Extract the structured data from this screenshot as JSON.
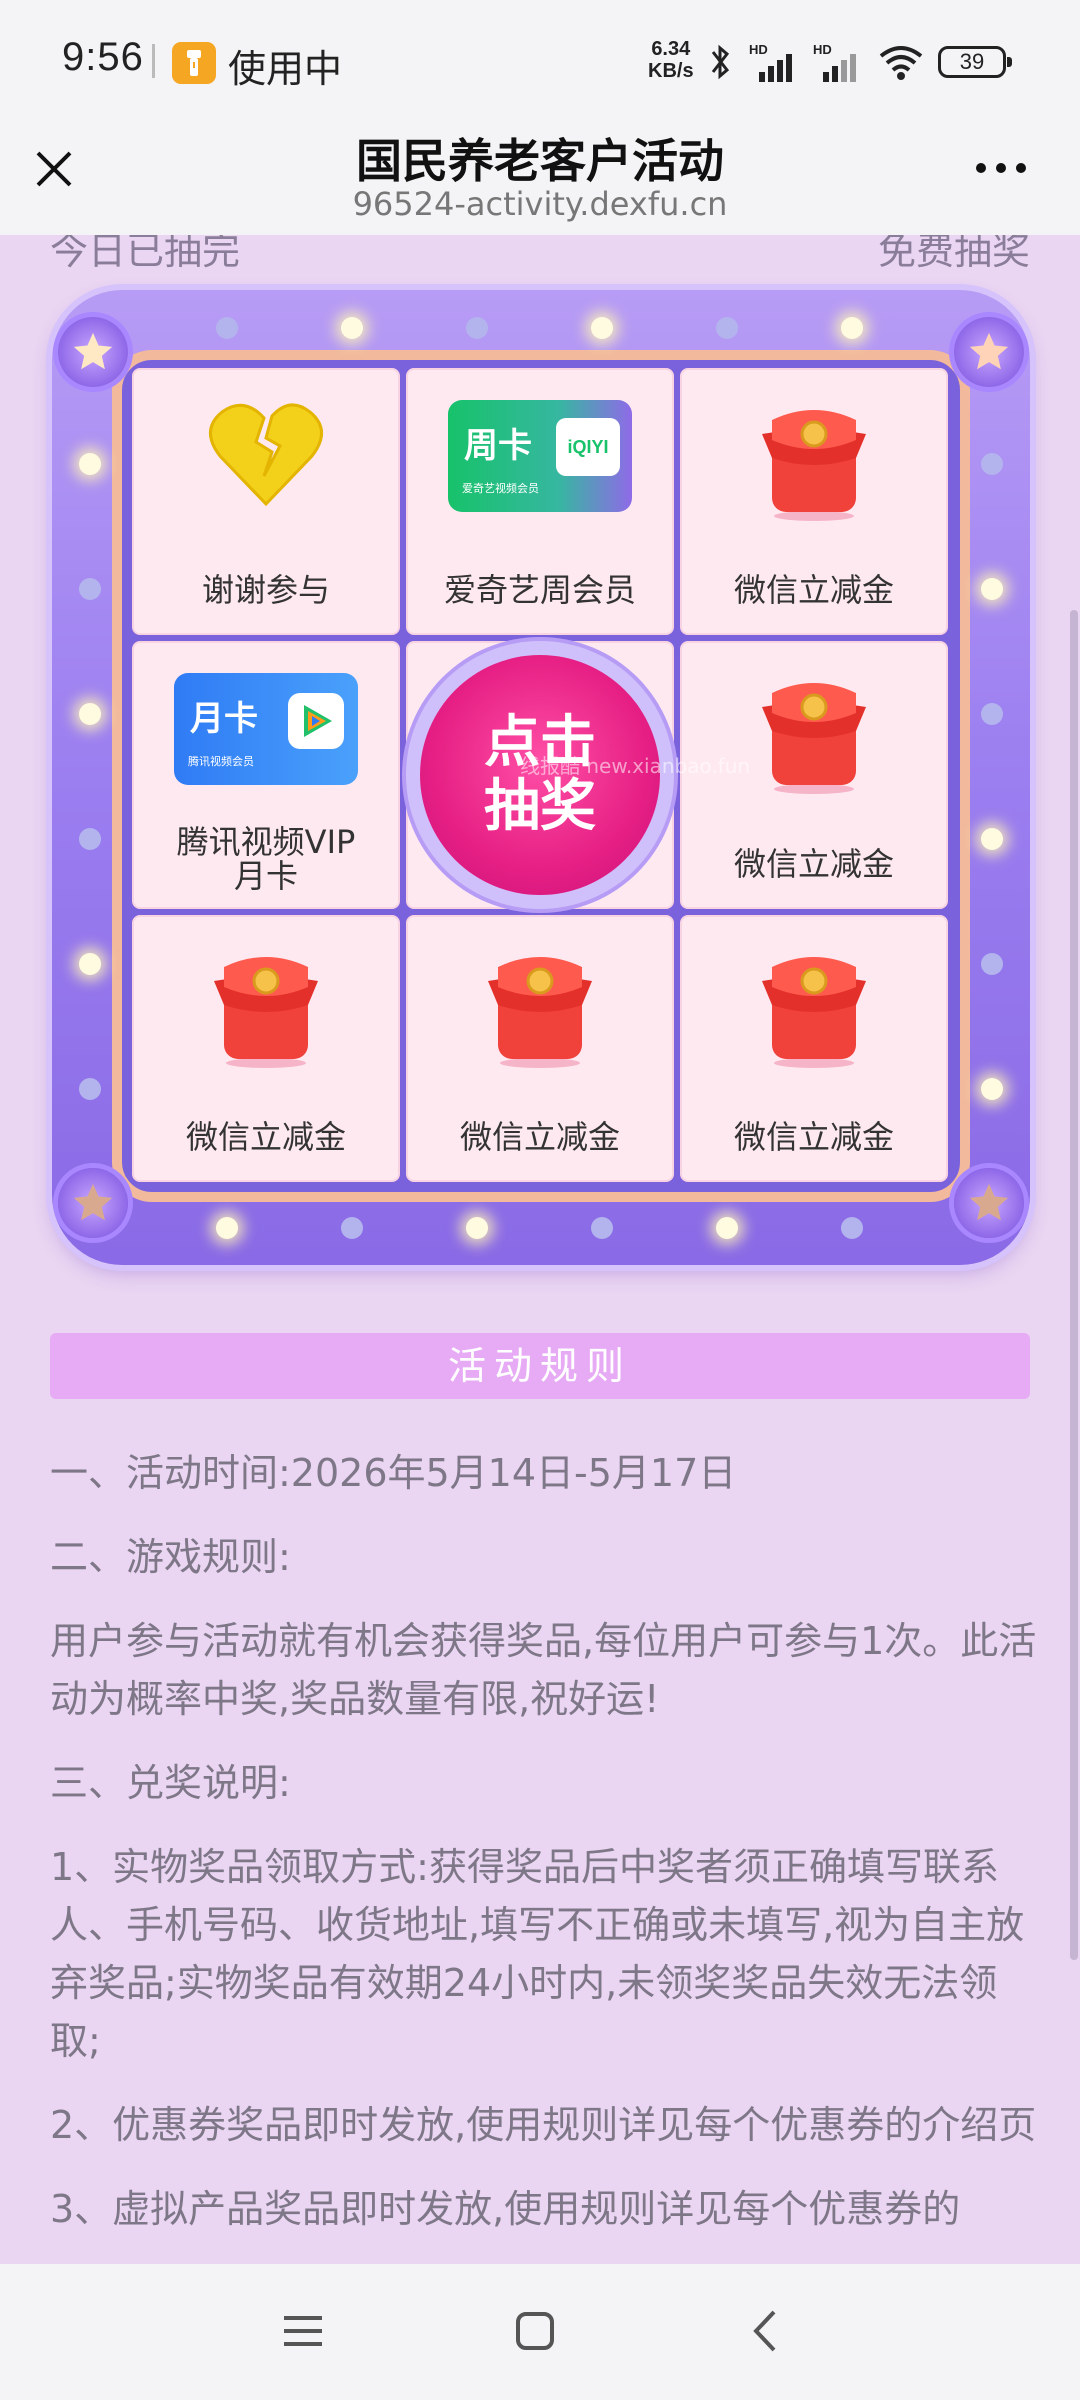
{
  "status_bar": {
    "time": "9:56",
    "usage_label": "使用中",
    "net_speed_value": "6.34",
    "net_speed_unit": "KB/s",
    "hd1": "HD",
    "hd2": "HD",
    "battery": "39"
  },
  "header": {
    "title": "国民养老客户活动",
    "url": "96524-activity.dexfu.cn"
  },
  "top_row": {
    "left": "今日已抽完",
    "right": "免费抽奖"
  },
  "prizes": [
    {
      "label": "谢谢参与",
      "icon": "broken-heart-icon"
    },
    {
      "label": "爱奇艺周会员",
      "icon": "iqiyi-week-card-icon",
      "badge": "周卡",
      "brand": "iQIYI",
      "sub": "爱奇艺视频会员"
    },
    {
      "label": "微信立减金",
      "icon": "red-envelope-icon"
    },
    {
      "label": "腾讯视频VIP月卡",
      "icon": "tencent-month-card-icon",
      "badge": "月卡",
      "sub": "腾讯视频会员"
    },
    {
      "label": "微信立减金",
      "icon": "red-envelope-icon"
    },
    {
      "label": "微信立减金",
      "icon": "red-envelope-icon"
    },
    {
      "label": "微信立减金",
      "icon": "red-envelope-icon"
    },
    {
      "label": "微信立减金",
      "icon": "red-envelope-icon"
    }
  ],
  "tencent_label_line1": "腾讯视频VIP",
  "tencent_label_line2": "月卡",
  "draw_button": {
    "line1": "点击",
    "line2": "抽奖"
  },
  "watermark": "线报酷 new.xianbao.fun",
  "rules": {
    "title": "活动规则",
    "items": [
      "一、活动时间:2026年5月14日-5月17日",
      "二、游戏规则:",
      "用户参与活动就有机会获得奖品,每位用户可参与1次。此活动为概率中奖,奖品数量有限,祝好运!",
      "三、兑奖说明:",
      "1、实物奖品领取方式:获得奖品后中奖者须正确填写联系人、手机号码、收货地址,填写不正确或未填写,视为自主放弃奖品;实物奖品有效期24小时内,未领奖奖品失效无法领取;",
      "2、优惠券奖品即时发放,使用规则详见每个优惠券的介绍页",
      "3、虚拟产品奖品即时发放,使用规则详见每个优惠券的"
    ]
  },
  "colors": {
    "page_bg": "#ead5f2",
    "board": "#9b7ef0",
    "cell_bg": "#ffe9f1",
    "draw_button": "#e61f84",
    "rules_header": "#e7abf5"
  }
}
